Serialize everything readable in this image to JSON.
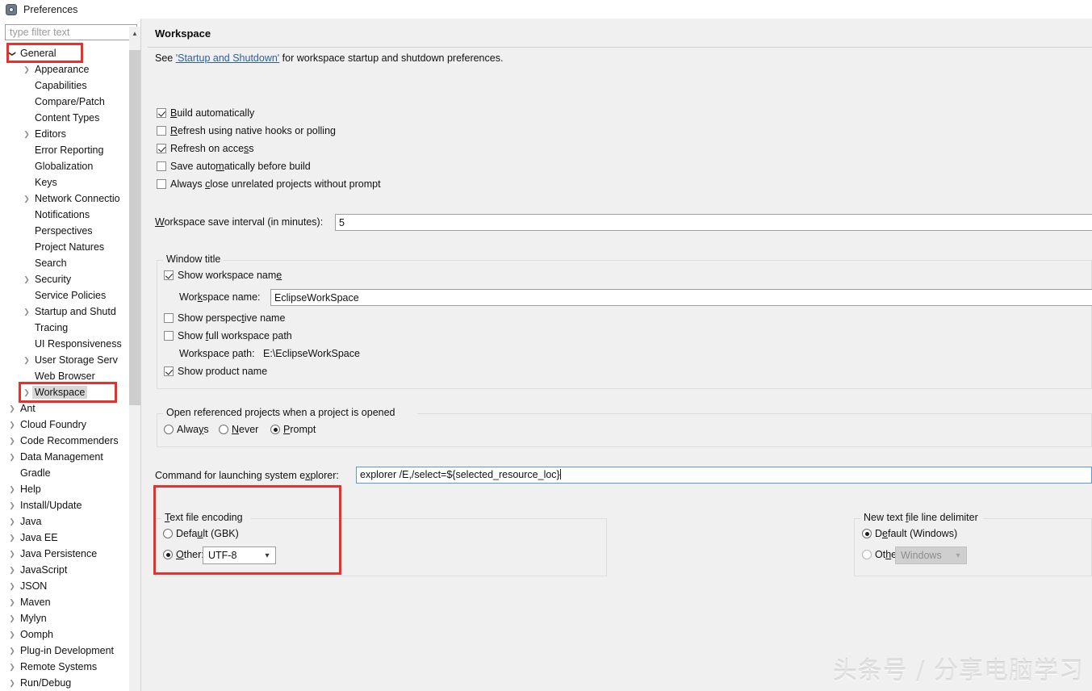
{
  "window": {
    "title": "Preferences",
    "icon": "preferences-gear-icon"
  },
  "sidebar": {
    "filter": {
      "placeholder": "type filter text",
      "value": ""
    },
    "items": [
      {
        "label": "General",
        "indent": 0,
        "arrow": "expanded",
        "selected": false
      },
      {
        "label": "Appearance",
        "indent": 1,
        "arrow": "collapsed",
        "selected": false
      },
      {
        "label": "Capabilities",
        "indent": 1,
        "arrow": "none",
        "selected": false
      },
      {
        "label": "Compare/Patch",
        "indent": 1,
        "arrow": "none",
        "selected": false
      },
      {
        "label": "Content Types",
        "indent": 1,
        "arrow": "none",
        "selected": false
      },
      {
        "label": "Editors",
        "indent": 1,
        "arrow": "collapsed",
        "selected": false
      },
      {
        "label": "Error Reporting",
        "indent": 1,
        "arrow": "none",
        "selected": false
      },
      {
        "label": "Globalization",
        "indent": 1,
        "arrow": "none",
        "selected": false
      },
      {
        "label": "Keys",
        "indent": 1,
        "arrow": "none",
        "selected": false
      },
      {
        "label": "Network Connectio",
        "indent": 1,
        "arrow": "collapsed",
        "selected": false
      },
      {
        "label": "Notifications",
        "indent": 1,
        "arrow": "none",
        "selected": false
      },
      {
        "label": "Perspectives",
        "indent": 1,
        "arrow": "none",
        "selected": false
      },
      {
        "label": "Project Natures",
        "indent": 1,
        "arrow": "none",
        "selected": false
      },
      {
        "label": "Search",
        "indent": 1,
        "arrow": "none",
        "selected": false
      },
      {
        "label": "Security",
        "indent": 1,
        "arrow": "collapsed",
        "selected": false
      },
      {
        "label": "Service Policies",
        "indent": 1,
        "arrow": "none",
        "selected": false
      },
      {
        "label": "Startup and Shutd",
        "indent": 1,
        "arrow": "collapsed",
        "selected": false
      },
      {
        "label": "Tracing",
        "indent": 1,
        "arrow": "none",
        "selected": false
      },
      {
        "label": "UI Responsiveness",
        "indent": 1,
        "arrow": "none",
        "selected": false
      },
      {
        "label": "User Storage Serv",
        "indent": 1,
        "arrow": "collapsed",
        "selected": false
      },
      {
        "label": "Web Browser",
        "indent": 1,
        "arrow": "none",
        "selected": false
      },
      {
        "label": "Workspace",
        "indent": 1,
        "arrow": "collapsed",
        "selected": true
      },
      {
        "label": "Ant",
        "indent": 0,
        "arrow": "collapsed",
        "selected": false
      },
      {
        "label": "Cloud Foundry",
        "indent": 0,
        "arrow": "collapsed",
        "selected": false
      },
      {
        "label": "Code Recommenders",
        "indent": 0,
        "arrow": "collapsed",
        "selected": false
      },
      {
        "label": "Data Management",
        "indent": 0,
        "arrow": "collapsed",
        "selected": false
      },
      {
        "label": "Gradle",
        "indent": 0,
        "arrow": "none",
        "selected": false
      },
      {
        "label": "Help",
        "indent": 0,
        "arrow": "collapsed",
        "selected": false
      },
      {
        "label": "Install/Update",
        "indent": 0,
        "arrow": "collapsed",
        "selected": false
      },
      {
        "label": "Java",
        "indent": 0,
        "arrow": "collapsed",
        "selected": false
      },
      {
        "label": "Java EE",
        "indent": 0,
        "arrow": "collapsed",
        "selected": false
      },
      {
        "label": "Java Persistence",
        "indent": 0,
        "arrow": "collapsed",
        "selected": false
      },
      {
        "label": "JavaScript",
        "indent": 0,
        "arrow": "collapsed",
        "selected": false
      },
      {
        "label": "JSON",
        "indent": 0,
        "arrow": "collapsed",
        "selected": false
      },
      {
        "label": "Maven",
        "indent": 0,
        "arrow": "collapsed",
        "selected": false
      },
      {
        "label": "Mylyn",
        "indent": 0,
        "arrow": "collapsed",
        "selected": false
      },
      {
        "label": "Oomph",
        "indent": 0,
        "arrow": "collapsed",
        "selected": false
      },
      {
        "label": "Plug-in Development",
        "indent": 0,
        "arrow": "collapsed",
        "selected": false
      },
      {
        "label": "Remote Systems",
        "indent": 0,
        "arrow": "collapsed",
        "selected": false
      },
      {
        "label": "Run/Debug",
        "indent": 0,
        "arrow": "collapsed",
        "selected": false
      }
    ],
    "scrollbar": {
      "up_arrow_icon": "chevron-up-icon"
    }
  },
  "page": {
    "title": "Workspace",
    "intro": {
      "prefix": "See ",
      "link": "'Startup and Shutdown'",
      "suffix": " for workspace startup and shutdown preferences."
    },
    "checkboxes": [
      {
        "label_pre": "",
        "mnemonic": "B",
        "label_post": "uild automatically",
        "checked": true
      },
      {
        "label_pre": "",
        "mnemonic": "R",
        "label_post": "efresh using native hooks or polling",
        "checked": false
      },
      {
        "label_pre": "Refresh on acce",
        "mnemonic": "s",
        "label_post": "s",
        "checked": true
      },
      {
        "label_pre": "Save auto",
        "mnemonic": "m",
        "label_post": "atically before build",
        "checked": false
      },
      {
        "label_pre": "Always ",
        "mnemonic": "c",
        "label_post": "lose unrelated projects without prompt",
        "checked": false
      }
    ],
    "save_interval": {
      "label_pre": "",
      "mnemonic": "W",
      "label_post": "orkspace save interval (in minutes):",
      "value": "5"
    },
    "window_title_group": {
      "title": "Window title",
      "show_workspace_name": {
        "label_pre": "Show workspace nam",
        "mnemonic": "e",
        "label_post": "",
        "checked": true
      },
      "workspace_name_label_pre": "Wor",
      "workspace_name_mnemonic": "k",
      "workspace_name_label_post": "space name:",
      "workspace_name_value": "EclipseWorkSpace",
      "show_perspective_name": {
        "label_pre": "Show perspec",
        "mnemonic": "t",
        "label_post": "ive name",
        "checked": false
      },
      "show_full_workspace_path": {
        "label_pre": "Show ",
        "mnemonic": "f",
        "label_post": "ull workspace path",
        "checked": false
      },
      "workspace_path_label": "Workspace path:",
      "workspace_path_value": "E:\\EclipseWorkSpace",
      "show_product_name": {
        "label_pre": "Show product name",
        "mnemonic": "",
        "label_post": "",
        "checked": true
      }
    },
    "open_referenced_group": {
      "title": "Open referenced projects when a project is opened",
      "options": [
        {
          "label_pre": "Alwa",
          "mnemonic": "y",
          "label_post": "s",
          "selected": false
        },
        {
          "label_pre": "",
          "mnemonic": "N",
          "label_post": "ever",
          "selected": false
        },
        {
          "label_pre": "",
          "mnemonic": "P",
          "label_post": "rompt",
          "selected": true
        }
      ]
    },
    "explorer_command": {
      "label_pre": "Command for launching system e",
      "mnemonic": "x",
      "label_post": "plorer:",
      "value": "explorer /E,/select=${selected_resource_loc}",
      "focused": true
    },
    "text_file_encoding": {
      "title_pre": "",
      "title_mnemonic": "T",
      "title_post": "ext file encoding",
      "default_option": {
        "label_pre": "Defa",
        "mnemonic": "u",
        "label_post": "lt (GBK)",
        "selected": false
      },
      "other_option": {
        "label_pre": "",
        "mnemonic": "O",
        "label_post": "ther:",
        "selected": true
      },
      "encoding_value": "UTF-8",
      "chevron_icon": "chevron-down-icon"
    },
    "line_delimiter": {
      "title_pre": "New text ",
      "title_mnemonic": "f",
      "title_post": "ile line delimiter",
      "default_option": {
        "label_pre": "D",
        "mnemonic": "e",
        "label_post": "fault (Windows)",
        "selected": true
      },
      "other_option": {
        "label_pre": "Ot",
        "mnemonic": "h",
        "label_post": "er:",
        "selected": false
      },
      "delimiter_value": "Windows",
      "disabled": true,
      "chevron_icon": "chevron-down-icon"
    }
  },
  "watermark": {
    "text": "头条号 / 分享电脑学习"
  },
  "annotations": {
    "accent_color": "#e8302c",
    "boxes": [
      "general-tree-item",
      "workspace-tree-item",
      "text-file-encoding-group"
    ]
  }
}
